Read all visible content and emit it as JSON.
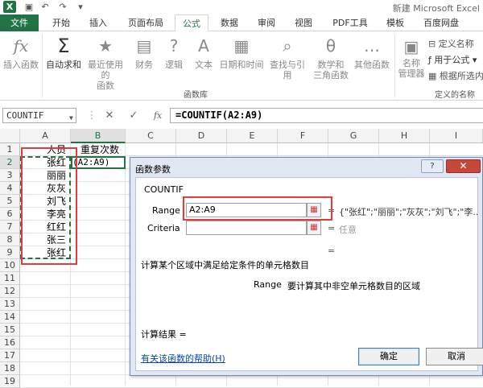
{
  "window": {
    "title": "新建 Microsoft Excel",
    "logo": "X"
  },
  "tabs": [
    "文件",
    "开始",
    "插入",
    "页面布局",
    "公式",
    "数据",
    "审阅",
    "视图",
    "PDF工具",
    "模板",
    "百度网盘"
  ],
  "ribbon": {
    "buttons": [
      {
        "icon": "fx",
        "label": "插入函数"
      },
      {
        "icon": "Σ",
        "label": "自动求和"
      },
      {
        "icon": "★",
        "label": "最近使用的\n函数"
      },
      {
        "icon": "▤",
        "label": "财务"
      },
      {
        "icon": "?",
        "label": "逻辑"
      },
      {
        "icon": "A",
        "label": "文本"
      },
      {
        "icon": "▦",
        "label": "日期和时间"
      },
      {
        "icon": "⌕",
        "label": "查找与引用"
      },
      {
        "icon": "θ",
        "label": "数学和\n三角函数"
      },
      {
        "icon": "…",
        "label": "其他函数"
      },
      {
        "icon": "▣",
        "label": "名称\n管理器"
      }
    ],
    "group_label": "函数库",
    "names_group": {
      "define": "定义名称",
      "use": "用于公式",
      "create": "根据所选内容",
      "label": "定义的名称"
    }
  },
  "formula_bar": {
    "name_box": "COUNTIF",
    "cancel": "✕",
    "enter": "✓",
    "fx": "fx",
    "formula": "=COUNTIF(A2:A9)"
  },
  "sheet": {
    "columns": [
      "A",
      "B",
      "C",
      "D",
      "E",
      "F",
      "G",
      "H",
      "I"
    ],
    "rows": [
      "1",
      "2",
      "3",
      "4",
      "5",
      "6",
      "7",
      "8",
      "9",
      "10",
      "11",
      "12",
      "13",
      "14",
      "15",
      "16",
      "17",
      "18",
      "19"
    ],
    "a_values": [
      "人员",
      "张红",
      "丽丽",
      "灰灰",
      "刘飞",
      "李亮",
      "红红",
      "张三",
      "张红"
    ],
    "b1": "重复次数",
    "b2": "(A2:A9)"
  },
  "dialog": {
    "title": "函数参数",
    "help": "?",
    "close": "✕",
    "function_name": "COUNTIF",
    "range_label": "Range",
    "range_value": "A2:A9",
    "range_result": "{\"张红\";\"丽丽\";\"灰灰\";\"刘飞\";\"李...",
    "criteria_label": "Criteria",
    "criteria_value": "",
    "criteria_result": "任意",
    "eq": "=",
    "description": "计算某个区域中满足给定条件的单元格数目",
    "arg_help_name": "Range",
    "arg_help_text": "要计算其中非空单元格数目的区域",
    "result_label": "计算结果 =",
    "help_link": "有关该函数的帮助(H)",
    "ok": "确定",
    "cancel": "取消"
  }
}
